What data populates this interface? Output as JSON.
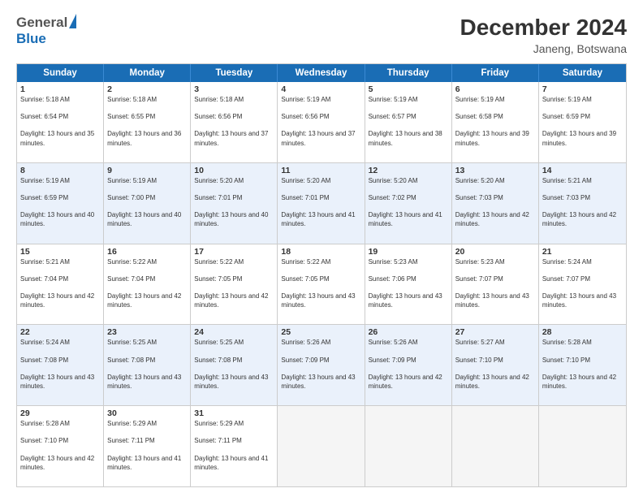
{
  "header": {
    "logo_general": "General",
    "logo_blue": "Blue",
    "title": "December 2024",
    "subtitle": "Janeng, Botswana"
  },
  "calendar": {
    "days_of_week": [
      "Sunday",
      "Monday",
      "Tuesday",
      "Wednesday",
      "Thursday",
      "Friday",
      "Saturday"
    ],
    "weeks": [
      [
        {
          "day": "",
          "empty": true
        },
        {
          "day": "",
          "empty": true
        },
        {
          "day": "",
          "empty": true
        },
        {
          "day": "",
          "empty": true
        },
        {
          "day": "",
          "empty": true
        },
        {
          "day": "",
          "empty": true
        },
        {
          "day": "",
          "empty": true
        }
      ],
      [
        {
          "day": "1",
          "sunrise": "5:18 AM",
          "sunset": "6:54 PM",
          "daylight": "13 hours and 35 minutes."
        },
        {
          "day": "2",
          "sunrise": "5:18 AM",
          "sunset": "6:55 PM",
          "daylight": "13 hours and 36 minutes."
        },
        {
          "day": "3",
          "sunrise": "5:18 AM",
          "sunset": "6:56 PM",
          "daylight": "13 hours and 37 minutes."
        },
        {
          "day": "4",
          "sunrise": "5:19 AM",
          "sunset": "6:56 PM",
          "daylight": "13 hours and 37 minutes."
        },
        {
          "day": "5",
          "sunrise": "5:19 AM",
          "sunset": "6:57 PM",
          "daylight": "13 hours and 38 minutes."
        },
        {
          "day": "6",
          "sunrise": "5:19 AM",
          "sunset": "6:58 PM",
          "daylight": "13 hours and 39 minutes."
        },
        {
          "day": "7",
          "sunrise": "5:19 AM",
          "sunset": "6:59 PM",
          "daylight": "13 hours and 39 minutes."
        }
      ],
      [
        {
          "day": "8",
          "sunrise": "5:19 AM",
          "sunset": "6:59 PM",
          "daylight": "13 hours and 40 minutes."
        },
        {
          "day": "9",
          "sunrise": "5:19 AM",
          "sunset": "7:00 PM",
          "daylight": "13 hours and 40 minutes."
        },
        {
          "day": "10",
          "sunrise": "5:20 AM",
          "sunset": "7:01 PM",
          "daylight": "13 hours and 40 minutes."
        },
        {
          "day": "11",
          "sunrise": "5:20 AM",
          "sunset": "7:01 PM",
          "daylight": "13 hours and 41 minutes."
        },
        {
          "day": "12",
          "sunrise": "5:20 AM",
          "sunset": "7:02 PM",
          "daylight": "13 hours and 41 minutes."
        },
        {
          "day": "13",
          "sunrise": "5:20 AM",
          "sunset": "7:03 PM",
          "daylight": "13 hours and 42 minutes."
        },
        {
          "day": "14",
          "sunrise": "5:21 AM",
          "sunset": "7:03 PM",
          "daylight": "13 hours and 42 minutes."
        }
      ],
      [
        {
          "day": "15",
          "sunrise": "5:21 AM",
          "sunset": "7:04 PM",
          "daylight": "13 hours and 42 minutes."
        },
        {
          "day": "16",
          "sunrise": "5:22 AM",
          "sunset": "7:04 PM",
          "daylight": "13 hours and 42 minutes."
        },
        {
          "day": "17",
          "sunrise": "5:22 AM",
          "sunset": "7:05 PM",
          "daylight": "13 hours and 42 minutes."
        },
        {
          "day": "18",
          "sunrise": "5:22 AM",
          "sunset": "7:05 PM",
          "daylight": "13 hours and 43 minutes."
        },
        {
          "day": "19",
          "sunrise": "5:23 AM",
          "sunset": "7:06 PM",
          "daylight": "13 hours and 43 minutes."
        },
        {
          "day": "20",
          "sunrise": "5:23 AM",
          "sunset": "7:07 PM",
          "daylight": "13 hours and 43 minutes."
        },
        {
          "day": "21",
          "sunrise": "5:24 AM",
          "sunset": "7:07 PM",
          "daylight": "13 hours and 43 minutes."
        }
      ],
      [
        {
          "day": "22",
          "sunrise": "5:24 AM",
          "sunset": "7:08 PM",
          "daylight": "13 hours and 43 minutes."
        },
        {
          "day": "23",
          "sunrise": "5:25 AM",
          "sunset": "7:08 PM",
          "daylight": "13 hours and 43 minutes."
        },
        {
          "day": "24",
          "sunrise": "5:25 AM",
          "sunset": "7:08 PM",
          "daylight": "13 hours and 43 minutes."
        },
        {
          "day": "25",
          "sunrise": "5:26 AM",
          "sunset": "7:09 PM",
          "daylight": "13 hours and 43 minutes."
        },
        {
          "day": "26",
          "sunrise": "5:26 AM",
          "sunset": "7:09 PM",
          "daylight": "13 hours and 42 minutes."
        },
        {
          "day": "27",
          "sunrise": "5:27 AM",
          "sunset": "7:10 PM",
          "daylight": "13 hours and 42 minutes."
        },
        {
          "day": "28",
          "sunrise": "5:28 AM",
          "sunset": "7:10 PM",
          "daylight": "13 hours and 42 minutes."
        }
      ],
      [
        {
          "day": "29",
          "sunrise": "5:28 AM",
          "sunset": "7:10 PM",
          "daylight": "13 hours and 42 minutes."
        },
        {
          "day": "30",
          "sunrise": "5:29 AM",
          "sunset": "7:11 PM",
          "daylight": "13 hours and 41 minutes."
        },
        {
          "day": "31",
          "sunrise": "5:29 AM",
          "sunset": "7:11 PM",
          "daylight": "13 hours and 41 minutes."
        },
        {
          "day": "",
          "empty": true
        },
        {
          "day": "",
          "empty": true
        },
        {
          "day": "",
          "empty": true
        },
        {
          "day": "",
          "empty": true
        }
      ]
    ]
  }
}
